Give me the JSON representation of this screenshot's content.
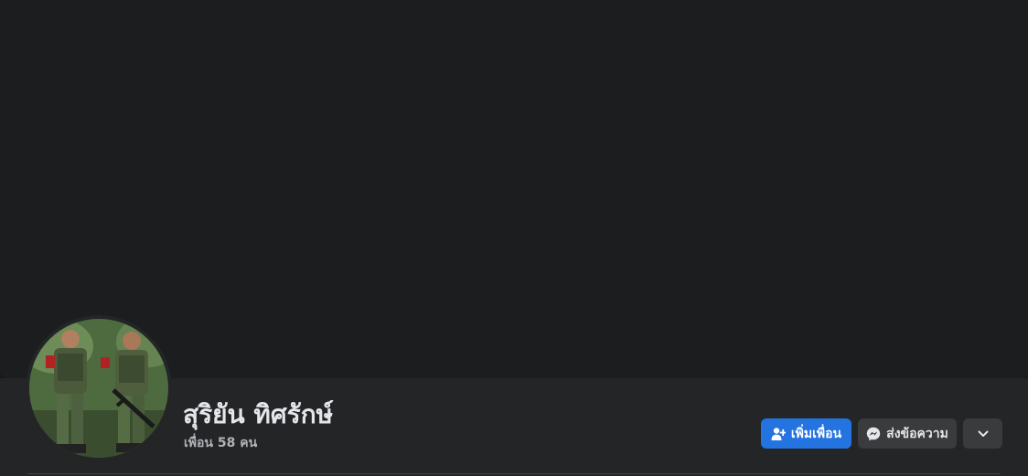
{
  "profile": {
    "name": "สุริยัน ทิศรักษ์",
    "friends_text": "เพื่อน 58 คน"
  },
  "actions": {
    "add_friend_label": "เพิ่มเพื่อน",
    "message_label": "ส่งข้อความ",
    "more_icon": "chevron-down-icon"
  },
  "colors": {
    "background": "#18191a",
    "header": "#242526",
    "primary_button": "#2374e1",
    "secondary_button": "#3a3b3c"
  }
}
